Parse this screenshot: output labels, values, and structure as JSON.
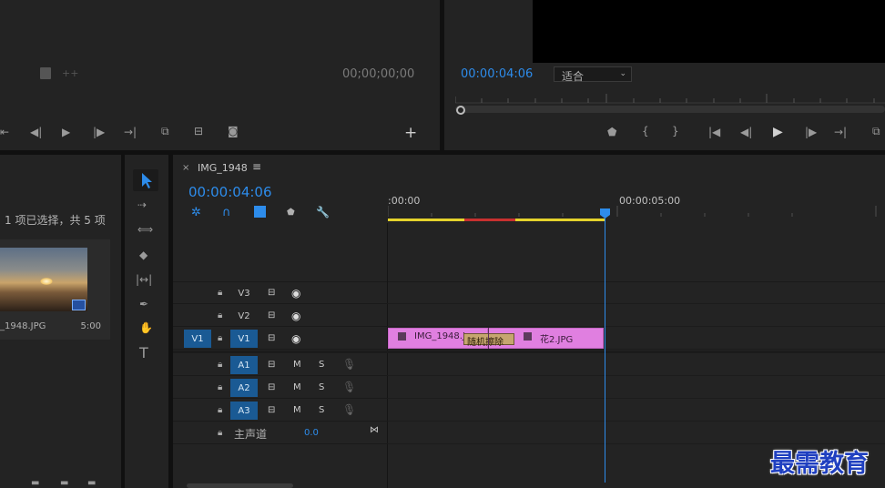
{
  "source_monitor": {
    "timecode": "00;00;00;00"
  },
  "program_monitor": {
    "timecode": "00:00:04:06",
    "zoom_option": "适合"
  },
  "project_panel": {
    "selection_text": "1 项已选择，共 5 项",
    "clip_name": "_1948.JPG",
    "clip_duration": "5:00"
  },
  "timeline": {
    "tab_label": "IMG_1948",
    "timecode": "00:00:04:06",
    "ruler_labels": [
      ":00:00",
      "00:00:05:00"
    ],
    "video_tracks": [
      {
        "source": "",
        "label": "V3"
      },
      {
        "source": "",
        "label": "V2"
      },
      {
        "source": "V1",
        "label": "V1"
      }
    ],
    "audio_tracks": [
      {
        "label": "A1",
        "m": "M",
        "s": "S"
      },
      {
        "label": "A2",
        "m": "M",
        "s": "S"
      },
      {
        "label": "A3",
        "m": "M",
        "s": "S"
      }
    ],
    "master": {
      "label": "主声道",
      "value": "0.0"
    },
    "clips": {
      "clip1": "IMG_1948.J",
      "transition": "随机擦除",
      "clip2": "花2.JPG"
    }
  },
  "watermark": "最需教育",
  "colors": {
    "accent_blue": "#2d8ceb",
    "clip_pink": "#e07fe0",
    "track_active": "#1a5a94"
  }
}
